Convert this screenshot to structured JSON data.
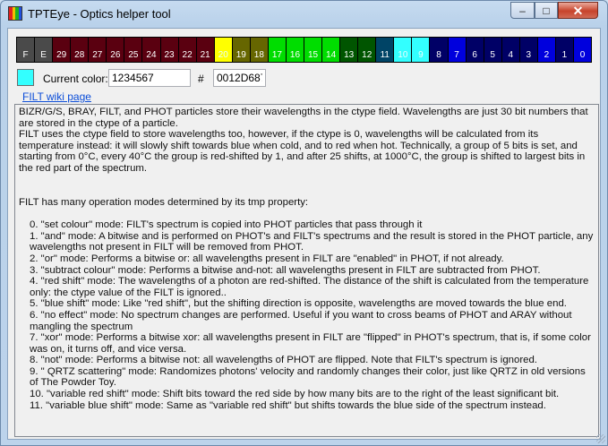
{
  "window": {
    "title": "TPTEye - Optics helper tool",
    "min_symbol": "–",
    "max_symbol": "□",
    "close_symbol": "✕"
  },
  "spectrum_bits": [
    {
      "label": "F",
      "color": "#4a4a4a"
    },
    {
      "label": "E",
      "color": "#4a4a4a"
    },
    {
      "label": "29",
      "color": "#5a0010"
    },
    {
      "label": "28",
      "color": "#5a0010"
    },
    {
      "label": "27",
      "color": "#5a0010"
    },
    {
      "label": "26",
      "color": "#5a0010"
    },
    {
      "label": "25",
      "color": "#5a0010"
    },
    {
      "label": "24",
      "color": "#5a0010"
    },
    {
      "label": "23",
      "color": "#5a0010"
    },
    {
      "label": "22",
      "color": "#5a0010"
    },
    {
      "label": "21",
      "color": "#5a0010"
    },
    {
      "label": "20",
      "color": "#ffff00"
    },
    {
      "label": "19",
      "color": "#666600"
    },
    {
      "label": "18",
      "color": "#666600"
    },
    {
      "label": "17",
      "color": "#00dd00"
    },
    {
      "label": "16",
      "color": "#00dd00"
    },
    {
      "label": "15",
      "color": "#00dd00"
    },
    {
      "label": "14",
      "color": "#00dd00"
    },
    {
      "label": "13",
      "color": "#005500"
    },
    {
      "label": "12",
      "color": "#005500"
    },
    {
      "label": "11",
      "color": "#004466"
    },
    {
      "label": "10",
      "color": "#33ffff"
    },
    {
      "label": "9",
      "color": "#33ffff"
    },
    {
      "label": "8",
      "color": "#000066"
    },
    {
      "label": "7",
      "color": "#0000dd"
    },
    {
      "label": "6",
      "color": "#000066"
    },
    {
      "label": "5",
      "color": "#000066"
    },
    {
      "label": "4",
      "color": "#000066"
    },
    {
      "label": "3",
      "color": "#000066"
    },
    {
      "label": "2",
      "color": "#0000dd"
    },
    {
      "label": "1",
      "color": "#000066"
    },
    {
      "label": "0",
      "color": "#0000dd"
    }
  ],
  "current_color": {
    "label": "Current color:",
    "value": "1234567",
    "hash_label": "#",
    "hex_value": "0012D687",
    "swatch_color": "#33ffff"
  },
  "wiki_link": "FILT wiki page",
  "doc": {
    "intro1": "BIZR/G/S, BRAY, FILT, and PHOT particles store their wavelengths in the ctype field. Wavelengths are just 30 bit numbers that are stored in the ctype of a particle.",
    "intro2": "FILT uses the ctype field to store wavelengths too, however, if the ctype is 0, wavelengths will be calculated from its temperature instead: it will slowly shift towards blue when cold, and to red when hot. Technically, a group of 5 bits is set, and starting from 0°C, every 40°C the group is red-shifted by 1, and after 25 shifts, at 1000°C, the group is shifted to largest bits in the red part of the spectrum.",
    "modes_intro": "FILT has many operation modes determined by its tmp property:",
    "modes": [
      "0. \"set colour\" mode: FILT's spectrum is copied into PHOT particles that pass through it",
      "1. \"and\" mode: A bitwise and is performed on PHOT's and FILT's spectrums and the result is stored in the PHOT particle, any wavelengths not present in FILT will be removed from PHOT.",
      "2. \"or\" mode: Performs a bitwise or: all wavelengths present in FILT are \"enabled\" in PHOT, if not already.",
      "3. \"subtract colour\" mode: Performs a bitwise and-not: all wavelengths present in FILT are subtracted from PHOT.",
      "4. \"red shift\" mode: The wavelengths of a photon are red-shifted. The distance of the shift is calculated from the temperature only: the ctype value of the FILT is ignored..",
      "5. \"blue shift\" mode: Like \"red shift\", but the shifting direction is opposite, wavelengths are moved towards the blue end.",
      "6. \"no effect\" mode: No spectrum changes are performed. Useful if you want to cross beams of PHOT and ARAY without mangling the spectrum",
      "7. \"xor\" mode: Performs a bitwise xor: all wavelengths present in FILT are \"flipped\" in PHOT's spectrum, that is, if some color was on, it turns off, and vice versa.",
      "8. \"not\" mode: Performs a bitwise not: all wavelengths of PHOT are flipped. Note that FILT's spectrum is ignored.",
      "9. \" QRTZ scattering\" mode: Randomizes photons' velocity and randomly changes their color, just like QRTZ in old versions of The Powder Toy.",
      "10. \"variable red shift\" mode: Shift bits toward the red side by how many bits are to the right of the least significant bit.",
      "11. \"variable blue shift\" mode: Same as \"variable red shift\" but shifts towards the blue side of the spectrum instead."
    ]
  }
}
